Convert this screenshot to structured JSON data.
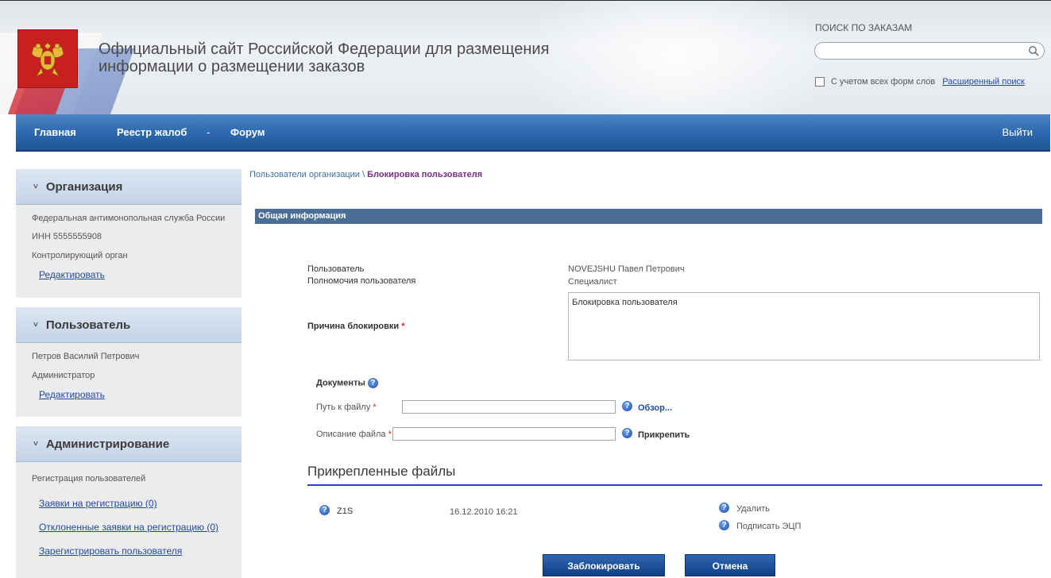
{
  "header": {
    "title_line1": "Официальный сайт Российской Федерации для размещения",
    "title_line2": "информации о размещении заказов",
    "search_label": "ПОИСК ПО ЗАКАЗАМ",
    "search_value": "",
    "all_forms_label": "С учетом всех форм слов",
    "advanced_search": "Расширенный поиск"
  },
  "nav": {
    "home": "Главная",
    "complaints": "Реестр жалоб",
    "complaints_arrow": "-",
    "forum": "Форум",
    "logout": "Выйти"
  },
  "sidebar": {
    "organization": {
      "title": "Организация",
      "name": "Федеральная антимонопольная служба России",
      "inn": "ИНН 5555555908",
      "role": "Контролирующий орган",
      "edit": "Редактировать"
    },
    "user": {
      "title": "Пользователь",
      "name": "Петров Василий Петрович",
      "role": "Администратор",
      "edit": "Редактировать"
    },
    "admin": {
      "title": "Администрирование",
      "section": "Регистрация пользователей",
      "links": [
        "Заявки на регистрацию (0)",
        "Отклоненные заявки на регистрацию (0)",
        "Зарегистрировать пользователя"
      ]
    }
  },
  "breadcrumb": {
    "parent": "Пользователи организации",
    "separator": "\\",
    "current": "Блокировка пользователя"
  },
  "main": {
    "section_title": "Общая информация",
    "user_label": "Пользователь",
    "user_value": "NOVEJSHU Павел Петрович",
    "rights_label": "Полномочия пользователя",
    "rights_value": "Специалист",
    "reason_label": "Причина блокировки",
    "reason_value": "Блокировка пользователя",
    "required_mark": "*",
    "documents_label": "Документы",
    "file_path_label": "Путь к файлу",
    "file_path_value": "",
    "browse": "Обзор...",
    "file_desc_label": "Описание файла",
    "file_desc_value": "",
    "attach": "Прикрепить",
    "attached_title": "Прикрепленные файлы",
    "files": [
      {
        "name": "Z1S",
        "date": "16.12.2010 16:21"
      }
    ],
    "delete": "Удалить",
    "sign": "Подписать ЭЦП",
    "block_button": "Заблокировать",
    "cancel_button": "Отмена"
  },
  "icons": {
    "help": "?",
    "chevron": "˅"
  },
  "colors": {
    "nav_blue": "#2f6aaf",
    "section_bar": "#4a6f96",
    "link": "#1f4aa8",
    "required": "#e0201e",
    "emblem_red": "#c8201f"
  }
}
